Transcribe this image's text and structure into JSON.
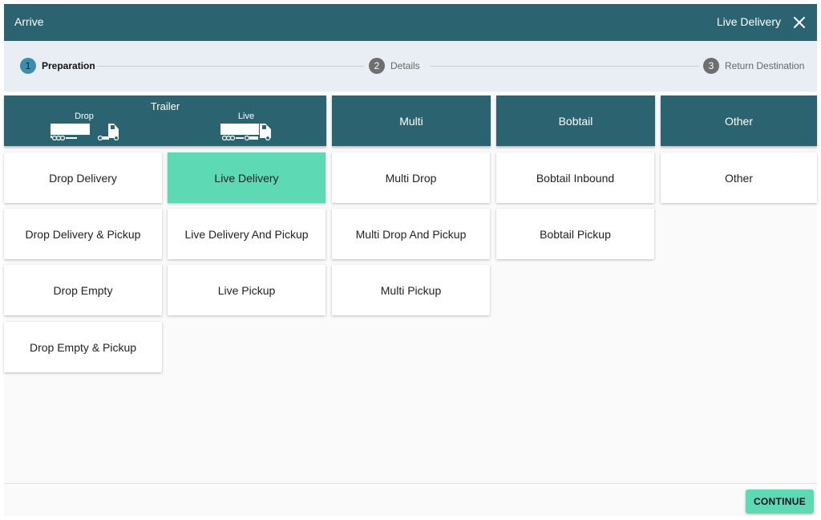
{
  "titlebar": {
    "title": "Arrive",
    "mode": "Live Delivery",
    "close_icon": "close-icon"
  },
  "stepper": {
    "steps": [
      {
        "number": "1",
        "label": "Preparation",
        "state": "active"
      },
      {
        "number": "2",
        "label": "Details",
        "state": "inactive"
      },
      {
        "number": "3",
        "label": "Return Destination",
        "state": "inactive"
      }
    ]
  },
  "columns": {
    "trailer": {
      "title": "Trailer",
      "drop_label": "Drop",
      "live_label": "Live"
    },
    "multi": {
      "title": "Multi"
    },
    "bobtail": {
      "title": "Bobtail"
    },
    "other": {
      "title": "Other"
    }
  },
  "options": {
    "drop": [
      "Drop Delivery",
      "Drop Delivery & Pickup",
      "Drop Empty",
      "Drop Empty & Pickup"
    ],
    "live": [
      "Live Delivery",
      "Live Delivery And Pickup",
      "Live Pickup"
    ],
    "multi": [
      "Multi Drop",
      "Multi Drop And Pickup",
      "Multi Pickup"
    ],
    "bobtail": [
      "Bobtail Inbound",
      "Bobtail Pickup"
    ],
    "other": [
      "Other"
    ]
  },
  "selected_option": "Live Delivery",
  "footer": {
    "continue_label": "CONTINUE"
  },
  "colors": {
    "header": "#2b6470",
    "accent": "#5dd9b4",
    "stepper_bg": "#e9eef4",
    "active_step": "#3a8dad"
  },
  "icons": {
    "drop_truck": "drop-truck-icon",
    "live_truck": "live-truck-icon"
  }
}
